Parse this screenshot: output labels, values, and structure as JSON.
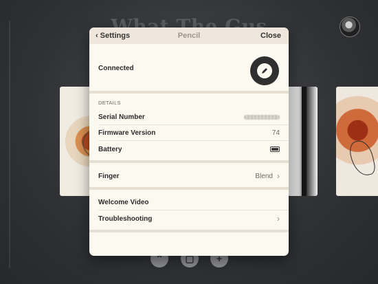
{
  "background": {
    "title": "What The Gus",
    "bottom_buttons": [
      "⌃",
      "▢",
      "+"
    ]
  },
  "popover": {
    "back_label": "Settings",
    "title": "Pencil",
    "close_label": "Close",
    "connected_label": "Connected",
    "details_header": "DETAILS",
    "serial_label": "Serial Number",
    "firmware_label": "Firmware Version",
    "firmware_value": "74",
    "battery_label": "Battery",
    "finger_label": "Finger",
    "finger_value": "Blend",
    "welcome_video_label": "Welcome Video",
    "troubleshooting_label": "Troubleshooting"
  },
  "icons": {
    "pencil": "pencil-icon",
    "battery": "battery-icon",
    "back": "chevron-left-icon",
    "forward": "chevron-right-icon"
  },
  "colors": {
    "popover_bg": "#fcf9f1",
    "header_bg": "#efe7db",
    "pencil_button": "#2f2f2f"
  }
}
